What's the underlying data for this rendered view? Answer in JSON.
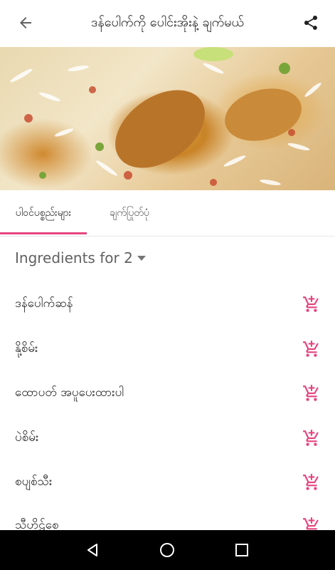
{
  "appbar": {
    "title": "ဒန်ပေါက်ကို ပေါင်းအိုးနဲ့ ချက်မယ်"
  },
  "tabs": [
    {
      "label": "ပါဝင်ပစ္စည်းများ",
      "selected": true
    },
    {
      "label": "ချက်ပြုတ်ပုံ",
      "selected": false
    }
  ],
  "ingredients": {
    "header": "Ingredients for 2",
    "items": [
      {
        "name": "ဒန်ပေါက်ဆန်"
      },
      {
        "name": "နို့စိမ်း"
      },
      {
        "name": "ထောပတ် အပူပေးထားပါ"
      },
      {
        "name": "ပဲစိမ်း"
      },
      {
        "name": "စပျစ်သီး"
      },
      {
        "name": "သီဟိုဠ်စေ့"
      }
    ]
  },
  "icons": {
    "back": "arrow-back-icon",
    "share": "share-icon",
    "cart": "add-shopping-cart-icon"
  },
  "colors": {
    "accent": "#e6447f",
    "navbar": "#000000"
  }
}
